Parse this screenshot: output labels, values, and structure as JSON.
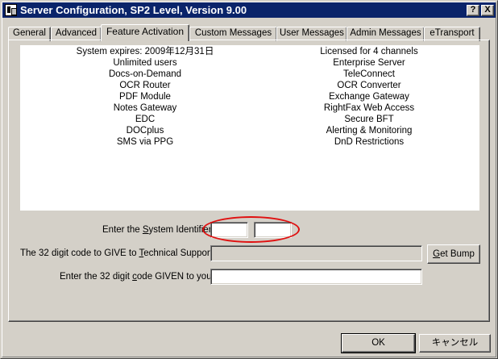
{
  "window": {
    "title": "Server Configuration, SP2 Level, Version 9.00",
    "help_button": "?",
    "close_button": "X"
  },
  "tabs": [
    {
      "label": "General",
      "active": false
    },
    {
      "label": "Advanced",
      "active": false
    },
    {
      "label": "Feature Activation",
      "active": true
    },
    {
      "label": "Custom Messages",
      "active": false
    },
    {
      "label": "User Messages",
      "active": false
    },
    {
      "label": "Admin Messages",
      "active": false
    },
    {
      "label": "eTransport",
      "active": false
    }
  ],
  "features": {
    "left": [
      "System expires: 2009年12月31日",
      "Unlimited users",
      "Docs-on-Demand",
      "OCR Router",
      "PDF Module",
      "Notes Gateway",
      "EDC",
      "DOCplus",
      "SMS via PPG"
    ],
    "right": [
      "Licensed for 4 channels",
      "Enterprise Server",
      "TeleConnect",
      "OCR Converter",
      "Exchange Gateway",
      "RightFax Web Access",
      "Secure BFT",
      "Alerting & Monitoring",
      "DnD Restrictions"
    ]
  },
  "form": {
    "system_identifier": {
      "prefix": "Enter the ",
      "underlined": "S",
      "suffix": "ystem Identifier:",
      "value1": "",
      "value2": ""
    },
    "give_code": {
      "prefix": "The 32 digit code to GIVE to ",
      "underlined": "T",
      "suffix": "echnical Support:",
      "value": ""
    },
    "given_code": {
      "prefix": "Enter the 32 digit ",
      "underlined": "c",
      "suffix": "ode GIVEN to you:",
      "value": ""
    },
    "get_bump": {
      "underlined": "G",
      "rest": "et Bump"
    }
  },
  "buttons": {
    "ok": "OK",
    "cancel": "キャンセル"
  },
  "colors": {
    "titlebar": "#0a246a",
    "face": "#d4d0c8",
    "annotation": "#e01010"
  }
}
